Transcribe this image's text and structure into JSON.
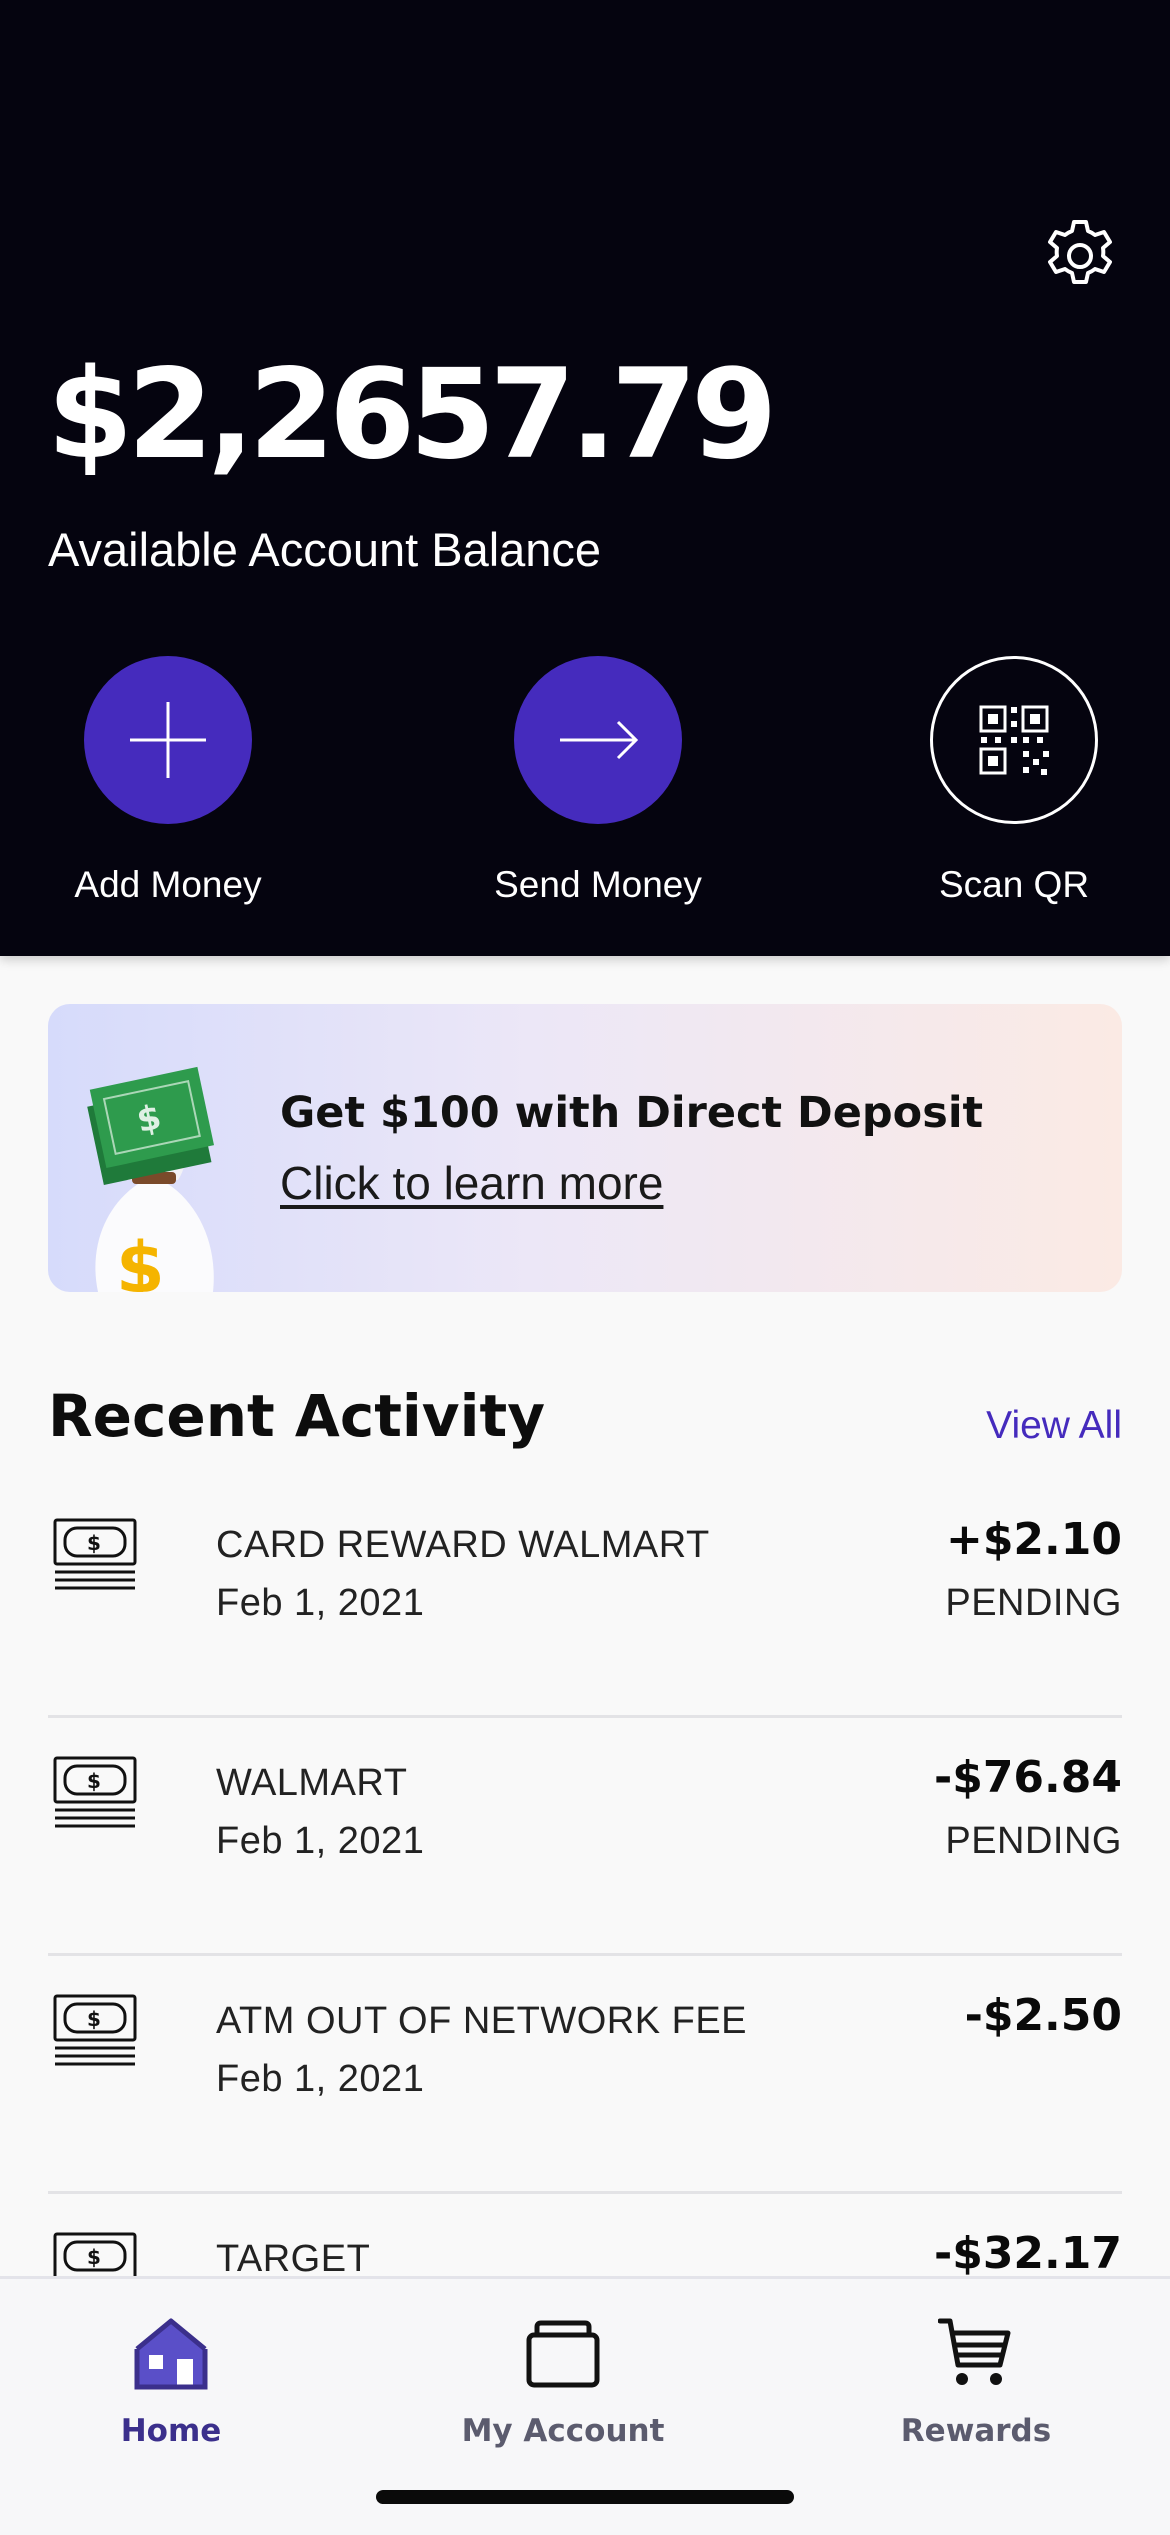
{
  "header": {
    "balance": "$2,2657.79",
    "balance_label": "Available Account Balance",
    "settings_icon": "gear-icon",
    "actions": [
      {
        "label": "Add Money",
        "icon": "plus-icon"
      },
      {
        "label": "Send Money",
        "icon": "arrow-right-icon"
      },
      {
        "label": "Scan QR",
        "icon": "qr-code-icon"
      }
    ]
  },
  "banner": {
    "title": "Get $100 with Direct Deposit",
    "link": "Click to learn more",
    "icon": "money-bag-icon"
  },
  "activity": {
    "title": "Recent Activity",
    "view_all": "View All",
    "items": [
      {
        "name": "CARD REWARD WALMART",
        "date": "Feb 1, 2021",
        "amount": "+$2.10",
        "status": "PENDING",
        "icon": "cash-icon"
      },
      {
        "name": "WALMART",
        "date": "Feb 1, 2021",
        "amount": "-$76.84",
        "status": "PENDING",
        "icon": "cash-icon"
      },
      {
        "name": "ATM OUT OF NETWORK FEE",
        "date": "Feb 1, 2021",
        "amount": "-$2.50",
        "status": "",
        "icon": "cash-icon"
      },
      {
        "name": "TARGET",
        "date": "",
        "amount": "-$32.17",
        "status": "",
        "icon": "cash-icon"
      }
    ]
  },
  "tabs": [
    {
      "label": "Home",
      "icon": "home-icon",
      "active": true
    },
    {
      "label": "My Account",
      "icon": "wallet-card-icon",
      "active": false
    },
    {
      "label": "Rewards",
      "icon": "cart-icon",
      "active": false
    }
  ],
  "colors": {
    "header_bg": "#05040f",
    "accent": "#452bbd",
    "tab_active": "#3b2f8c",
    "page_bg": "#f9f9f9"
  }
}
